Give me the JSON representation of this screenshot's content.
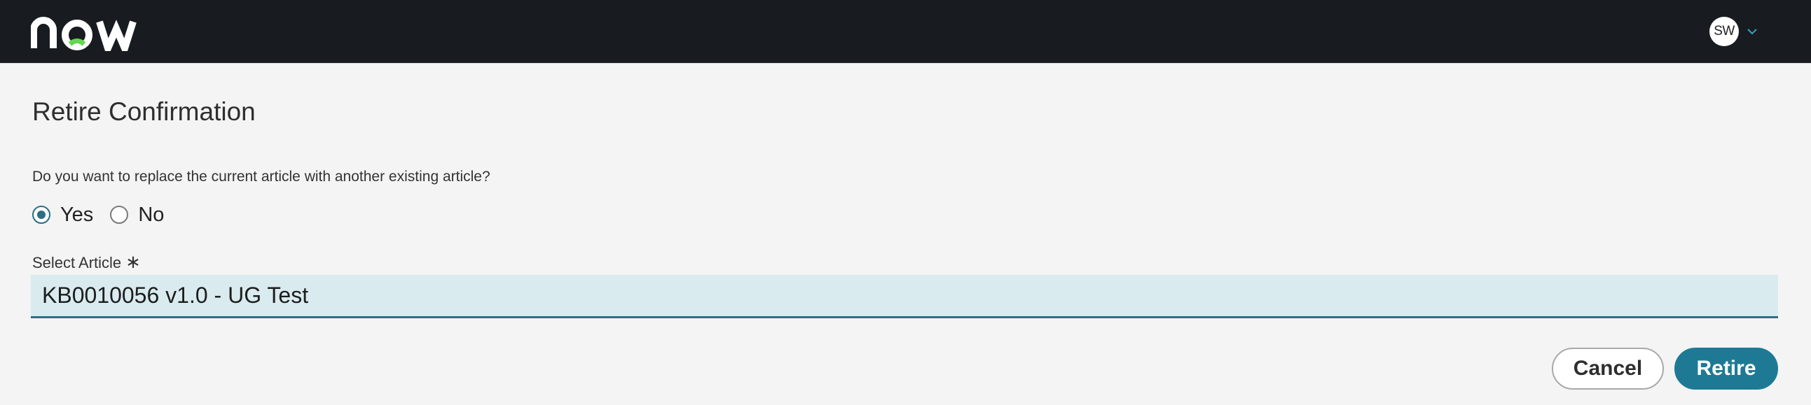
{
  "header": {
    "logo_text": "now",
    "user_initials": "SW",
    "colors": {
      "background": "#181c20",
      "logo": "#ffffff",
      "logo_accent": "#62d84e"
    }
  },
  "dialog": {
    "title": "Retire Confirmation",
    "question": "Do you want to replace the current article with another existing article?",
    "options": [
      {
        "label": "Yes",
        "selected": true
      },
      {
        "label": "No",
        "selected": false
      }
    ],
    "select_article": {
      "label": "Select Article",
      "required_marker": "∗",
      "value": "KB0010056 v1.0 - UG Test"
    },
    "buttons": {
      "cancel": "Cancel",
      "retire": "Retire"
    },
    "colors": {
      "accent": "#1e7a94",
      "input_bg": "#d9ebef"
    }
  }
}
